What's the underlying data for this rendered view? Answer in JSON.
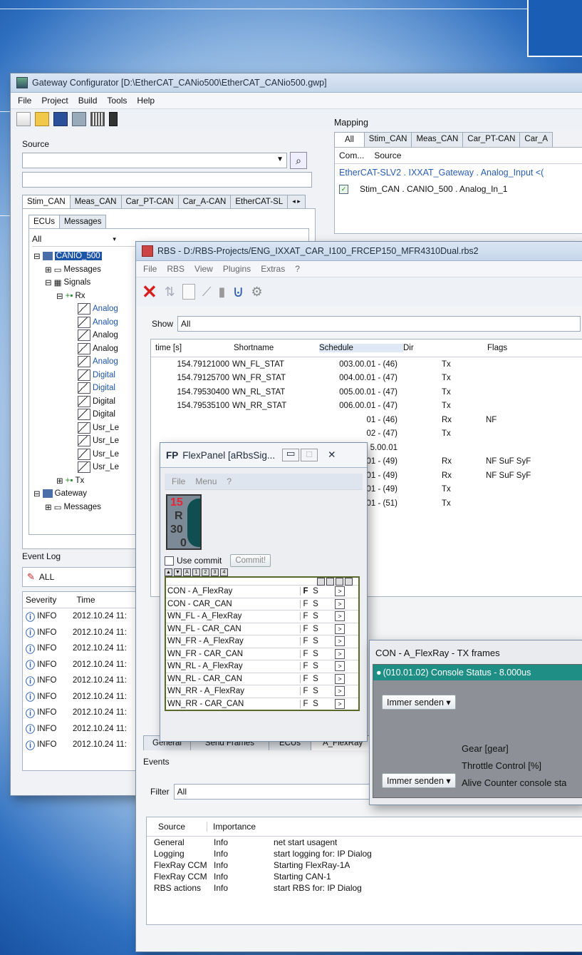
{
  "gateway": {
    "title": "Gateway Configurator [D:\\EtherCAT_CANio500\\EtherCAT_CANio500.gwp]",
    "menu": [
      "File",
      "Project",
      "Build",
      "Tools",
      "Help"
    ],
    "source_label": "Source",
    "tabs": [
      "Stim_CAN",
      "Meas_CAN",
      "Car_PT-CAN",
      "Car_A-CAN",
      "EtherCAT-SL"
    ],
    "subtabs": [
      "ECUs",
      "Messages"
    ],
    "filter_value": "All",
    "tree": {
      "root": "CANIO_500",
      "messages": "Messages",
      "signals": "Signals",
      "rx": "Rx",
      "signal_items": [
        "Analog",
        "Analog",
        "Analog",
        "Analog",
        "Analog",
        "Digital",
        "Digital",
        "Digital",
        "Digital",
        "Usr_Le",
        "Usr_Le",
        "Usr_Le",
        "Usr_Le"
      ],
      "tx": "Tx",
      "gateway": "Gateway",
      "gw_messages": "Messages"
    },
    "mapping": {
      "label": "Mapping",
      "tabs": [
        "All",
        "Stim_CAN",
        "Meas_CAN",
        "Car_PT-CAN",
        "Car_A"
      ],
      "columns": [
        "Com...",
        "Source"
      ],
      "row1": "EtherCAT-SLV2 . IXXAT_Gateway . Analog_Input <(",
      "row2": "Stim_CAN . CANIO_500 . Analog_In_1"
    },
    "event_log": {
      "label": "Event Log",
      "filter": "ALL",
      "columns": [
        "Severity",
        "Time"
      ],
      "rows": [
        {
          "severity": "INFO",
          "time": "2012.10.24 11:"
        },
        {
          "severity": "INFO",
          "time": "2012.10.24 11:"
        },
        {
          "severity": "INFO",
          "time": "2012.10.24 11:"
        },
        {
          "severity": "INFO",
          "time": "2012.10.24 11:"
        },
        {
          "severity": "INFO",
          "time": "2012.10.24 11:"
        },
        {
          "severity": "INFO",
          "time": "2012.10.24 11:"
        },
        {
          "severity": "INFO",
          "time": "2012.10.24 11:"
        },
        {
          "severity": "INFO",
          "time": "2012.10.24 11:"
        },
        {
          "severity": "INFO",
          "time": "2012.10.24 11:"
        }
      ]
    }
  },
  "rbs": {
    "title": "RBS - D:/RBS-Projects/ENG_IXXAT_CAR_I100_FRCEP150_MFR4310Dual.rbs2",
    "menu": [
      "File",
      "RBS",
      "View",
      "Plugins",
      "Extras",
      "?"
    ],
    "show_label": "Show",
    "show_value": "All",
    "columns": [
      "time [s]",
      "Shortname",
      "Schedule",
      "Dir",
      "Flags"
    ],
    "rows": [
      {
        "time": "154.79121000",
        "name": "WN_FL_STAT",
        "schedule": "003.00.01 - (46)",
        "dir": "Tx",
        "flags": ""
      },
      {
        "time": "154.79125700",
        "name": "WN_FR_STAT",
        "schedule": "004.00.01 - (47)",
        "dir": "Tx",
        "flags": ""
      },
      {
        "time": "154.79530400",
        "name": "WN_RL_STAT",
        "schedule": "005.00.01 - (47)",
        "dir": "Tx",
        "flags": ""
      },
      {
        "time": "154.79535100",
        "name": "WN_RR_STAT",
        "schedule": "006.00.01 - (47)",
        "dir": "Tx",
        "flags": ""
      },
      {
        "time": "",
        "name": "",
        "schedule": "01 - (46)",
        "dir": "Rx",
        "flags": "NF"
      },
      {
        "time": "",
        "name": "",
        "schedule": "02 - (47)",
        "dir": "Tx",
        "flags": ""
      },
      {
        "time": "",
        "name": "",
        "schedule": "5.00.01",
        "dir": "",
        "flags": ""
      },
      {
        "time": "",
        "name": "",
        "schedule": "01 - (49)",
        "dir": "Rx",
        "flags": "NF SuF SyF"
      },
      {
        "time": "",
        "name": "",
        "schedule": "01 - (49)",
        "dir": "Rx",
        "flags": "NF SuF SyF"
      },
      {
        "time": "",
        "name": "",
        "schedule": "01 - (49)",
        "dir": "Tx",
        "flags": ""
      },
      {
        "time": "",
        "name": "",
        "schedule": "01 - (51)",
        "dir": "Tx",
        "flags": ""
      }
    ],
    "bottom_tabs": [
      "General",
      "Send Frames",
      "ECUs",
      "A_FlexRay"
    ],
    "events_label": "Events",
    "filter_label": "Filter",
    "filter_value": "All",
    "event_columns": [
      "Source",
      "Importance"
    ],
    "events": [
      {
        "source": "General",
        "importance": "Info",
        "message": "net start usagent"
      },
      {
        "source": "Logging",
        "importance": "Info",
        "message": "start logging for: IP Dialog"
      },
      {
        "source": "FlexRay CCM",
        "importance": "Info",
        "message": "Starting FlexRay-1A"
      },
      {
        "source": "FlexRay CCM",
        "importance": "Info",
        "message": "Starting CAN-1"
      },
      {
        "source": "RBS actions",
        "importance": "Info",
        "message": "start RBS for: IP Dialog"
      }
    ]
  },
  "flexpanel": {
    "title": "FlexPanel [aRbsSig...",
    "logo": "FP",
    "menu": [
      "File",
      "Menu",
      "?"
    ],
    "gauge": [
      "15",
      "R",
      "30",
      "0"
    ],
    "use_commit": "Use commit",
    "commit_btn": "Commit!",
    "rows": [
      {
        "name": "CON - A_FlexRay",
        "f": "F",
        "s": "S"
      },
      {
        "name": "CON - CAR_CAN",
        "f": "F",
        "s": "S"
      },
      {
        "name": "WN_FL - A_FlexRay",
        "f": "F",
        "s": "S"
      },
      {
        "name": "WN_FL - CAR_CAN",
        "f": "F",
        "s": "S"
      },
      {
        "name": "WN_FR - A_FlexRay",
        "f": "F",
        "s": "S"
      },
      {
        "name": "WN_FR - CAR_CAN",
        "f": "F",
        "s": "S"
      },
      {
        "name": "WN_RL - A_FlexRay",
        "f": "F",
        "s": "S"
      },
      {
        "name": "WN_RL - CAR_CAN",
        "f": "F",
        "s": "S"
      },
      {
        "name": "WN_RR - A_FlexRay",
        "f": "F",
        "s": "S"
      },
      {
        "name": "WN_RR - CAR_CAN",
        "f": "F",
        "s": "S"
      }
    ]
  },
  "txframes": {
    "title": "CON - A_FlexRay - TX frames",
    "frame": "(010.01.02) Console Status - 8.000us",
    "dropdown1": "Immer senden",
    "dropdown2": "Immer senden",
    "signal1": "Gear [gear]",
    "signal2": "Throttle Control [%]",
    "signal3": "Alive Counter console sta"
  }
}
